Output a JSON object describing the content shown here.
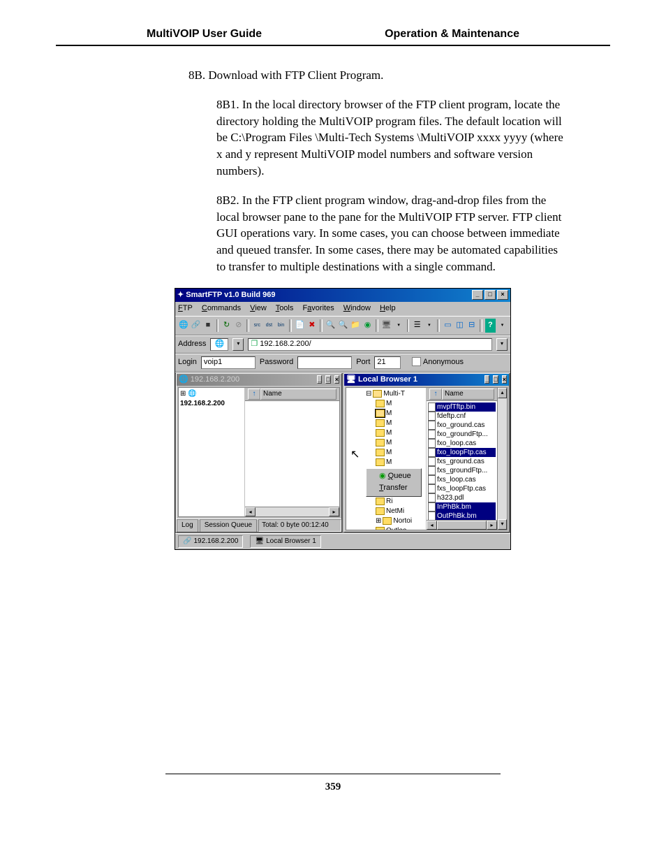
{
  "header": {
    "left": "MultiVOIP User Guide",
    "right": "Operation & Maintenance"
  },
  "body": {
    "step_main": "8B. Download with FTP Client Program.",
    "step_b1": "8B1. In the local directory browser of the FTP client program, locate the directory holding the MultiVOIP program files. The default location will be C:\\Program Files \\Multi-Tech Systems \\MultiVOIP xxxx yyyy (where x and y represent MultiVOIP model numbers and software version numbers).",
    "step_b2": "8B2. In the FTP client program window, drag-and-drop files from the local browser pane to the pane for the MultiVOIP FTP server.  FTP client GUI operations vary.  In some cases, you can choose between immediate and queued transfer.  In some cases, there may be automated capabilities to transfer to multiple destinations with a single command."
  },
  "ftp": {
    "title": "SmartFTP v1.0 Build 969",
    "menus": [
      "FTP",
      "Commands",
      "View",
      "Tools",
      "Favorites",
      "Window",
      "Help"
    ],
    "address_label": "Address",
    "address_value": "192.168.2.200/",
    "login_label": "Login",
    "login_value": "voip1",
    "password_label": "Password",
    "password_value": "",
    "port_label": "Port",
    "port_value": "21",
    "anonymous_label": "Anonymous",
    "left_pane": {
      "title": "192.168.2.200",
      "tree_root": "192.168.2.200",
      "col": "Name",
      "tabs": [
        "Log",
        "Session Queue"
      ],
      "status": "Total: 0 byte 00:12:40"
    },
    "right_pane": {
      "title": "Local Browser 1",
      "col": "Name",
      "tree": [
        "Multi-T",
        "M",
        "M",
        "M",
        "M",
        "M",
        "M",
        "M",
        "M",
        "M",
        "Ri",
        "Ri",
        "NetMi",
        "Nortoi",
        "Outloo"
      ],
      "files": [
        "mvpfTftp.bin",
        "fdeftp.cnf",
        "fxo_ground.cas",
        "fxo_groundFtp...",
        "fxo_loop.cas",
        "fxo_loopFtp.cas",
        "fxs_ground.cas",
        "fxs_groundFtp...",
        "fxs_loop.cas",
        "fxs_loopFtp.cas",
        "h323.pdl",
        "InPhBk.bm",
        "OutPhBk.bm"
      ],
      "selected": [
        0,
        5,
        11,
        12
      ],
      "context": [
        "Queue",
        "Transfer"
      ]
    },
    "statusbar": {
      "left": "192.168.2.200",
      "right": "Local Browser 1"
    }
  },
  "page_number": "359"
}
